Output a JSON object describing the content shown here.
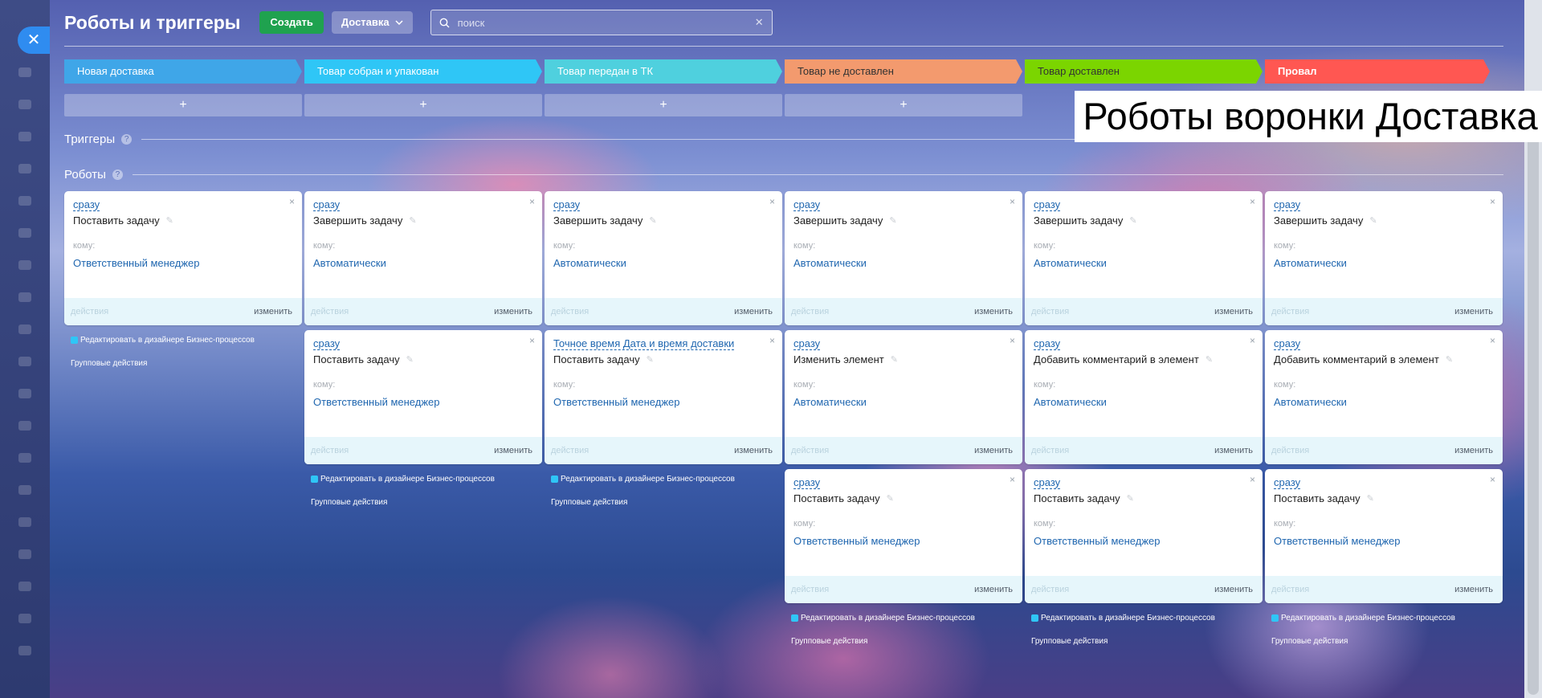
{
  "header": {
    "title": "Роботы и триггеры",
    "create_label": "Создать",
    "funnel_label": "Доставка",
    "search_placeholder": "поиск",
    "close_icon": "close-icon"
  },
  "caption": "Роботы воронки Доставка",
  "colors": {
    "stage_1": "#3fa6e8",
    "stage_2": "#2fc6f6",
    "stage_3": "#4fd0de",
    "stage_4": "#f39a6e",
    "stage_5": "#7bd500",
    "stage_6": "#ff5752"
  },
  "stages": [
    {
      "name": "Новая доставка"
    },
    {
      "name": "Товар собран и упакован"
    },
    {
      "name": "Товар передан в ТК"
    },
    {
      "name": "Товар не доставлен"
    },
    {
      "name": "Товар доставлен"
    },
    {
      "name": "Провал"
    }
  ],
  "add_label": "+",
  "sections": {
    "triggers": "Триггеры",
    "robots": "Роботы",
    "help": "?"
  },
  "card_labels": {
    "to": "кому:",
    "actions": "действия",
    "edit": "изменить",
    "close": "×"
  },
  "links": {
    "designer": "Редактировать в дизайнере Бизнес-процессов",
    "group": "Групповые действия"
  },
  "robots": [
    [
      {
        "delay": "сразу",
        "title": "Поставить задачу",
        "to": "Ответственный менеджер"
      }
    ],
    [
      {
        "delay": "сразу",
        "title": "Завершить задачу",
        "to": "Автоматически"
      },
      {
        "delay": "сразу",
        "title": "Поставить задачу",
        "to": "Ответственный менеджер"
      }
    ],
    [
      {
        "delay": "сразу",
        "title": "Завершить задачу",
        "to": "Автоматически"
      },
      {
        "delay": "Точное время Дата и время доставки",
        "title": "Поставить задачу",
        "to": "Ответственный менеджер"
      }
    ],
    [
      {
        "delay": "сразу",
        "title": "Завершить задачу",
        "to": "Автоматически"
      },
      {
        "delay": "сразу",
        "title": "Изменить элемент",
        "to": "Автоматически"
      },
      {
        "delay": "сразу",
        "title": "Поставить задачу",
        "to": "Ответственный менеджер"
      }
    ],
    [
      {
        "delay": "сразу",
        "title": "Завершить задачу",
        "to": "Автоматически"
      },
      {
        "delay": "сразу",
        "title": "Добавить комментарий в элемент",
        "to": "Автоматически"
      },
      {
        "delay": "сразу",
        "title": "Поставить задачу",
        "to": "Ответственный менеджер"
      }
    ],
    [
      {
        "delay": "сразу",
        "title": "Завершить задачу",
        "to": "Автоматически"
      },
      {
        "delay": "сразу",
        "title": "Добавить комментарий в элемент",
        "to": "Автоматически"
      },
      {
        "delay": "сразу",
        "title": "Поставить задачу",
        "to": "Ответственный менеджер"
      }
    ]
  ]
}
